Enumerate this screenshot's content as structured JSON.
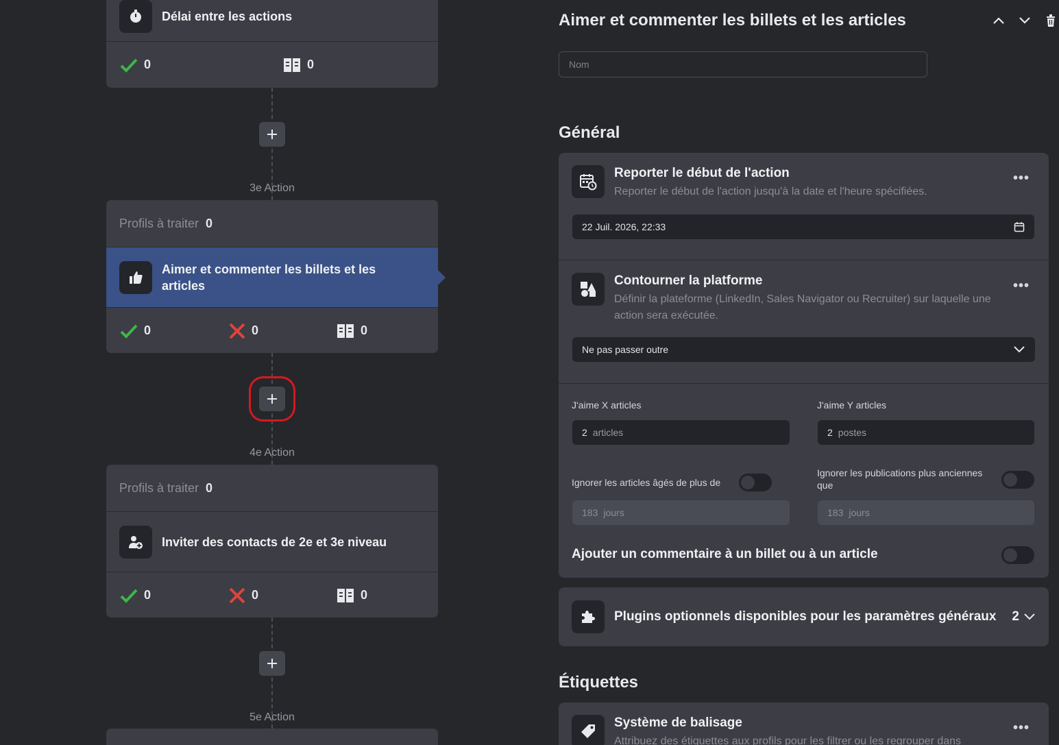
{
  "flow": {
    "card_top": {
      "title": "Délai entre les actions",
      "stats": {
        "success": "0",
        "skipped": "0"
      }
    },
    "labels": {
      "action3": "3e Action",
      "action4": "4e Action",
      "action5": "5e Action"
    },
    "card_3": {
      "profiles_label": "Profils à traiter",
      "profiles_count": "0",
      "title": "Aimer et commenter les billets et les articles",
      "stats": {
        "success": "0",
        "failed": "0",
        "skipped": "0"
      }
    },
    "card_4": {
      "profiles_label": "Profils à traiter",
      "profiles_count": "0",
      "title": "Inviter des contacts de 2e et 3e niveau",
      "stats": {
        "success": "0",
        "failed": "0",
        "skipped": "0"
      }
    }
  },
  "panel": {
    "title": "Aimer et commenter les billets et les articles",
    "name_placeholder": "Nom",
    "general_title": "Général",
    "delay": {
      "title": "Reporter le début de l'action",
      "desc": "Reporter le début de l'action jusqu'à la date et l'heure spécifiées.",
      "value": "22 Juil. 2026, 22:33"
    },
    "platform": {
      "title": "Contourner la platforme",
      "desc": "Définir la plateforme (LinkedIn, Sales Navigator ou Recruiter) sur laquelle une action sera exécutée.",
      "value": "Ne pas passer outre"
    },
    "likes": {
      "x_label": "J'aime X articles",
      "x_value": "2",
      "x_unit": "articles",
      "y_label": "J'aime Y articles",
      "y_value": "2",
      "y_unit": "postes",
      "ignore_articles_label": "Ignorer les articles âgés de plus de",
      "ignore_articles_value": "183",
      "ignore_articles_unit": "jours",
      "ignore_posts_label": "Ignorer les publications plus anciennes que",
      "ignore_posts_value": "183",
      "ignore_posts_unit": "jours",
      "comment_label": "Ajouter un commentaire à un billet ou à un article"
    },
    "plugins": {
      "title": "Plugins optionnels disponibles pour les paramètres généraux",
      "count": "2"
    },
    "tags_title": "Étiquettes",
    "tagging": {
      "title": "Système de balisage",
      "desc": "Attribuez des étiquettes aux profils pour les filtrer ou les regrouper dans"
    }
  },
  "colors": {
    "accent_active": "#3a5287",
    "success": "#3fb54a",
    "failed": "#e0433a",
    "highlight": "#d6191f"
  }
}
